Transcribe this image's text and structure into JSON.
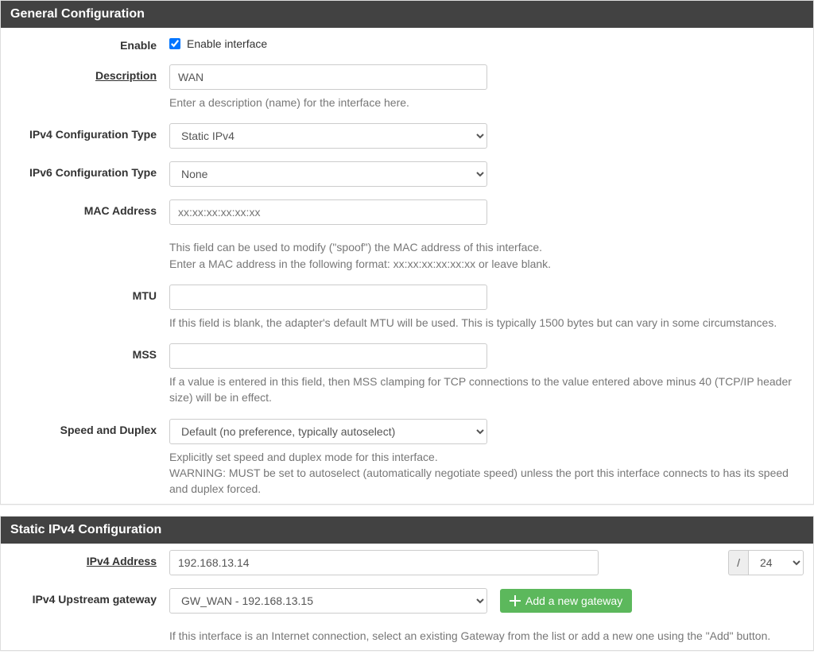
{
  "general": {
    "header": "General Configuration",
    "enable": {
      "label": "Enable",
      "checkbox_label": "Enable interface",
      "checked": true
    },
    "description": {
      "label": "Description",
      "value": "WAN",
      "help": "Enter a description (name) for the interface here."
    },
    "ipv4type": {
      "label": "IPv4 Configuration Type",
      "value": "Static IPv4"
    },
    "ipv6type": {
      "label": "IPv6 Configuration Type",
      "value": "None"
    },
    "mac": {
      "label": "MAC Address",
      "placeholder": "xx:xx:xx:xx:xx:xx",
      "value": "",
      "help1": "This field can be used to modify (\"spoof\") the MAC address of this interface.",
      "help2": "Enter a MAC address in the following format: xx:xx:xx:xx:xx:xx or leave blank."
    },
    "mtu": {
      "label": "MTU",
      "value": "",
      "help": "If this field is blank, the adapter's default MTU will be used. This is typically 1500 bytes but can vary in some circumstances."
    },
    "mss": {
      "label": "MSS",
      "value": "",
      "help": "If a value is entered in this field, then MSS clamping for TCP connections to the value entered above minus 40 (TCP/IP header size) will be in effect."
    },
    "speed": {
      "label": "Speed and Duplex",
      "value": "Default (no preference, typically autoselect)",
      "help1": "Explicitly set speed and duplex mode for this interface.",
      "help2": "WARNING: MUST be set to autoselect (automatically negotiate speed) unless the port this interface connects to has its speed and duplex forced."
    }
  },
  "static4": {
    "header": "Static IPv4 Configuration",
    "address": {
      "label": "IPv4 Address",
      "value": "192.168.13.14",
      "slash": "/",
      "cidr": "24"
    },
    "gateway": {
      "label": "IPv4 Upstream gateway",
      "value": "GW_WAN - 192.168.13.15",
      "add_button": "Add a new gateway",
      "help": "If this interface is an Internet connection, select an existing Gateway from the list or add a new one using the \"Add\" button."
    }
  }
}
